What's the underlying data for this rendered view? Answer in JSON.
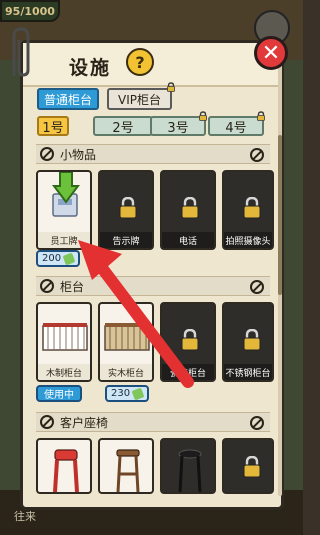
{
  "background": {
    "top_badge": "95/1000",
    "bottom_text": "往来"
  },
  "panel": {
    "title": "设施",
    "help_label": "?",
    "close_label": "✕"
  },
  "counter_tabs": [
    {
      "label": "普通柜台",
      "active": true,
      "locked": false
    },
    {
      "label": "VIP柜台",
      "active": false,
      "locked": true
    }
  ],
  "slot_tabs": [
    {
      "label": "1号",
      "active": true,
      "locked": false
    },
    {
      "label": "2号",
      "active": false,
      "locked": false
    },
    {
      "label": "3号",
      "active": false,
      "locked": true
    },
    {
      "label": "4号",
      "active": false,
      "locked": true
    }
  ],
  "sections": {
    "small_items": {
      "title": "小物品",
      "items": [
        {
          "label": "员工牌",
          "locked": false,
          "price": "200"
        },
        {
          "label": "告示牌",
          "locked": true
        },
        {
          "label": "电话",
          "locked": true
        },
        {
          "label": "拍照摄像头",
          "locked": true
        }
      ]
    },
    "counters": {
      "title": "柜台",
      "items": [
        {
          "label": "木制柜台",
          "locked": false,
          "status": "使用中"
        },
        {
          "label": "实木柜台",
          "locked": false,
          "price": "230"
        },
        {
          "label": "瓷砖柜台",
          "locked": true
        },
        {
          "label": "不锈钢柜台",
          "locked": true
        }
      ]
    },
    "customer_seats": {
      "title": "客户座椅"
    }
  },
  "colors": {
    "accent_blue": "#2e9bd6",
    "active_yellow": "#f6c643",
    "close_red": "#e23a3a",
    "arrow_red": "#e33030",
    "hint_green": "#6cc13a"
  }
}
